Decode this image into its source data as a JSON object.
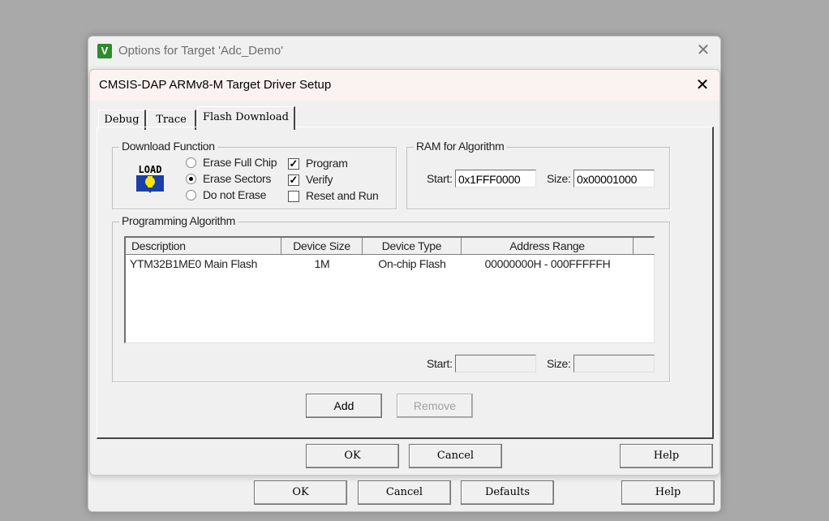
{
  "outer_window": {
    "title": "Options for Target 'Adc_Demo'",
    "icon_text": "V",
    "buttons": {
      "ok": "OK",
      "cancel": "Cancel",
      "defaults": "Defaults",
      "help": "Help"
    }
  },
  "dialog": {
    "title": "CMSIS-DAP ARMv8-M Target Driver Setup",
    "tabs": [
      {
        "label": "Debug",
        "active": false
      },
      {
        "label": "Trace",
        "active": false
      },
      {
        "label": "Flash Download",
        "active": true
      }
    ],
    "download_function": {
      "label": "Download Function",
      "icon_text": "LOAD",
      "erase_options": [
        {
          "label": "Erase Full Chip",
          "selected": false
        },
        {
          "label": "Erase Sectors",
          "selected": true
        },
        {
          "label": "Do not Erase",
          "selected": false
        }
      ],
      "checks": [
        {
          "label": "Program",
          "checked": true
        },
        {
          "label": "Verify",
          "checked": true
        },
        {
          "label": "Reset and Run",
          "checked": false
        }
      ]
    },
    "ram_for_algorithm": {
      "label": "RAM for Algorithm",
      "start_label": "Start:",
      "start_value": "0x1FFF0000",
      "size_label": "Size:",
      "size_value": "0x00001000"
    },
    "programming_algorithm": {
      "label": "Programming Algorithm",
      "columns": [
        "Description",
        "Device Size",
        "Device Type",
        "Address Range"
      ],
      "rows": [
        {
          "description": "YTM32B1ME0 Main Flash",
          "device_size": "1M",
          "device_type": "On-chip Flash",
          "address_range": "00000000H - 000FFFFFH"
        }
      ],
      "start_label": "Start:",
      "start_value": "",
      "size_label": "Size:",
      "size_value": ""
    },
    "add_button": "Add",
    "remove_button": "Remove",
    "buttons": {
      "ok": "OK",
      "cancel": "Cancel",
      "help": "Help"
    }
  }
}
